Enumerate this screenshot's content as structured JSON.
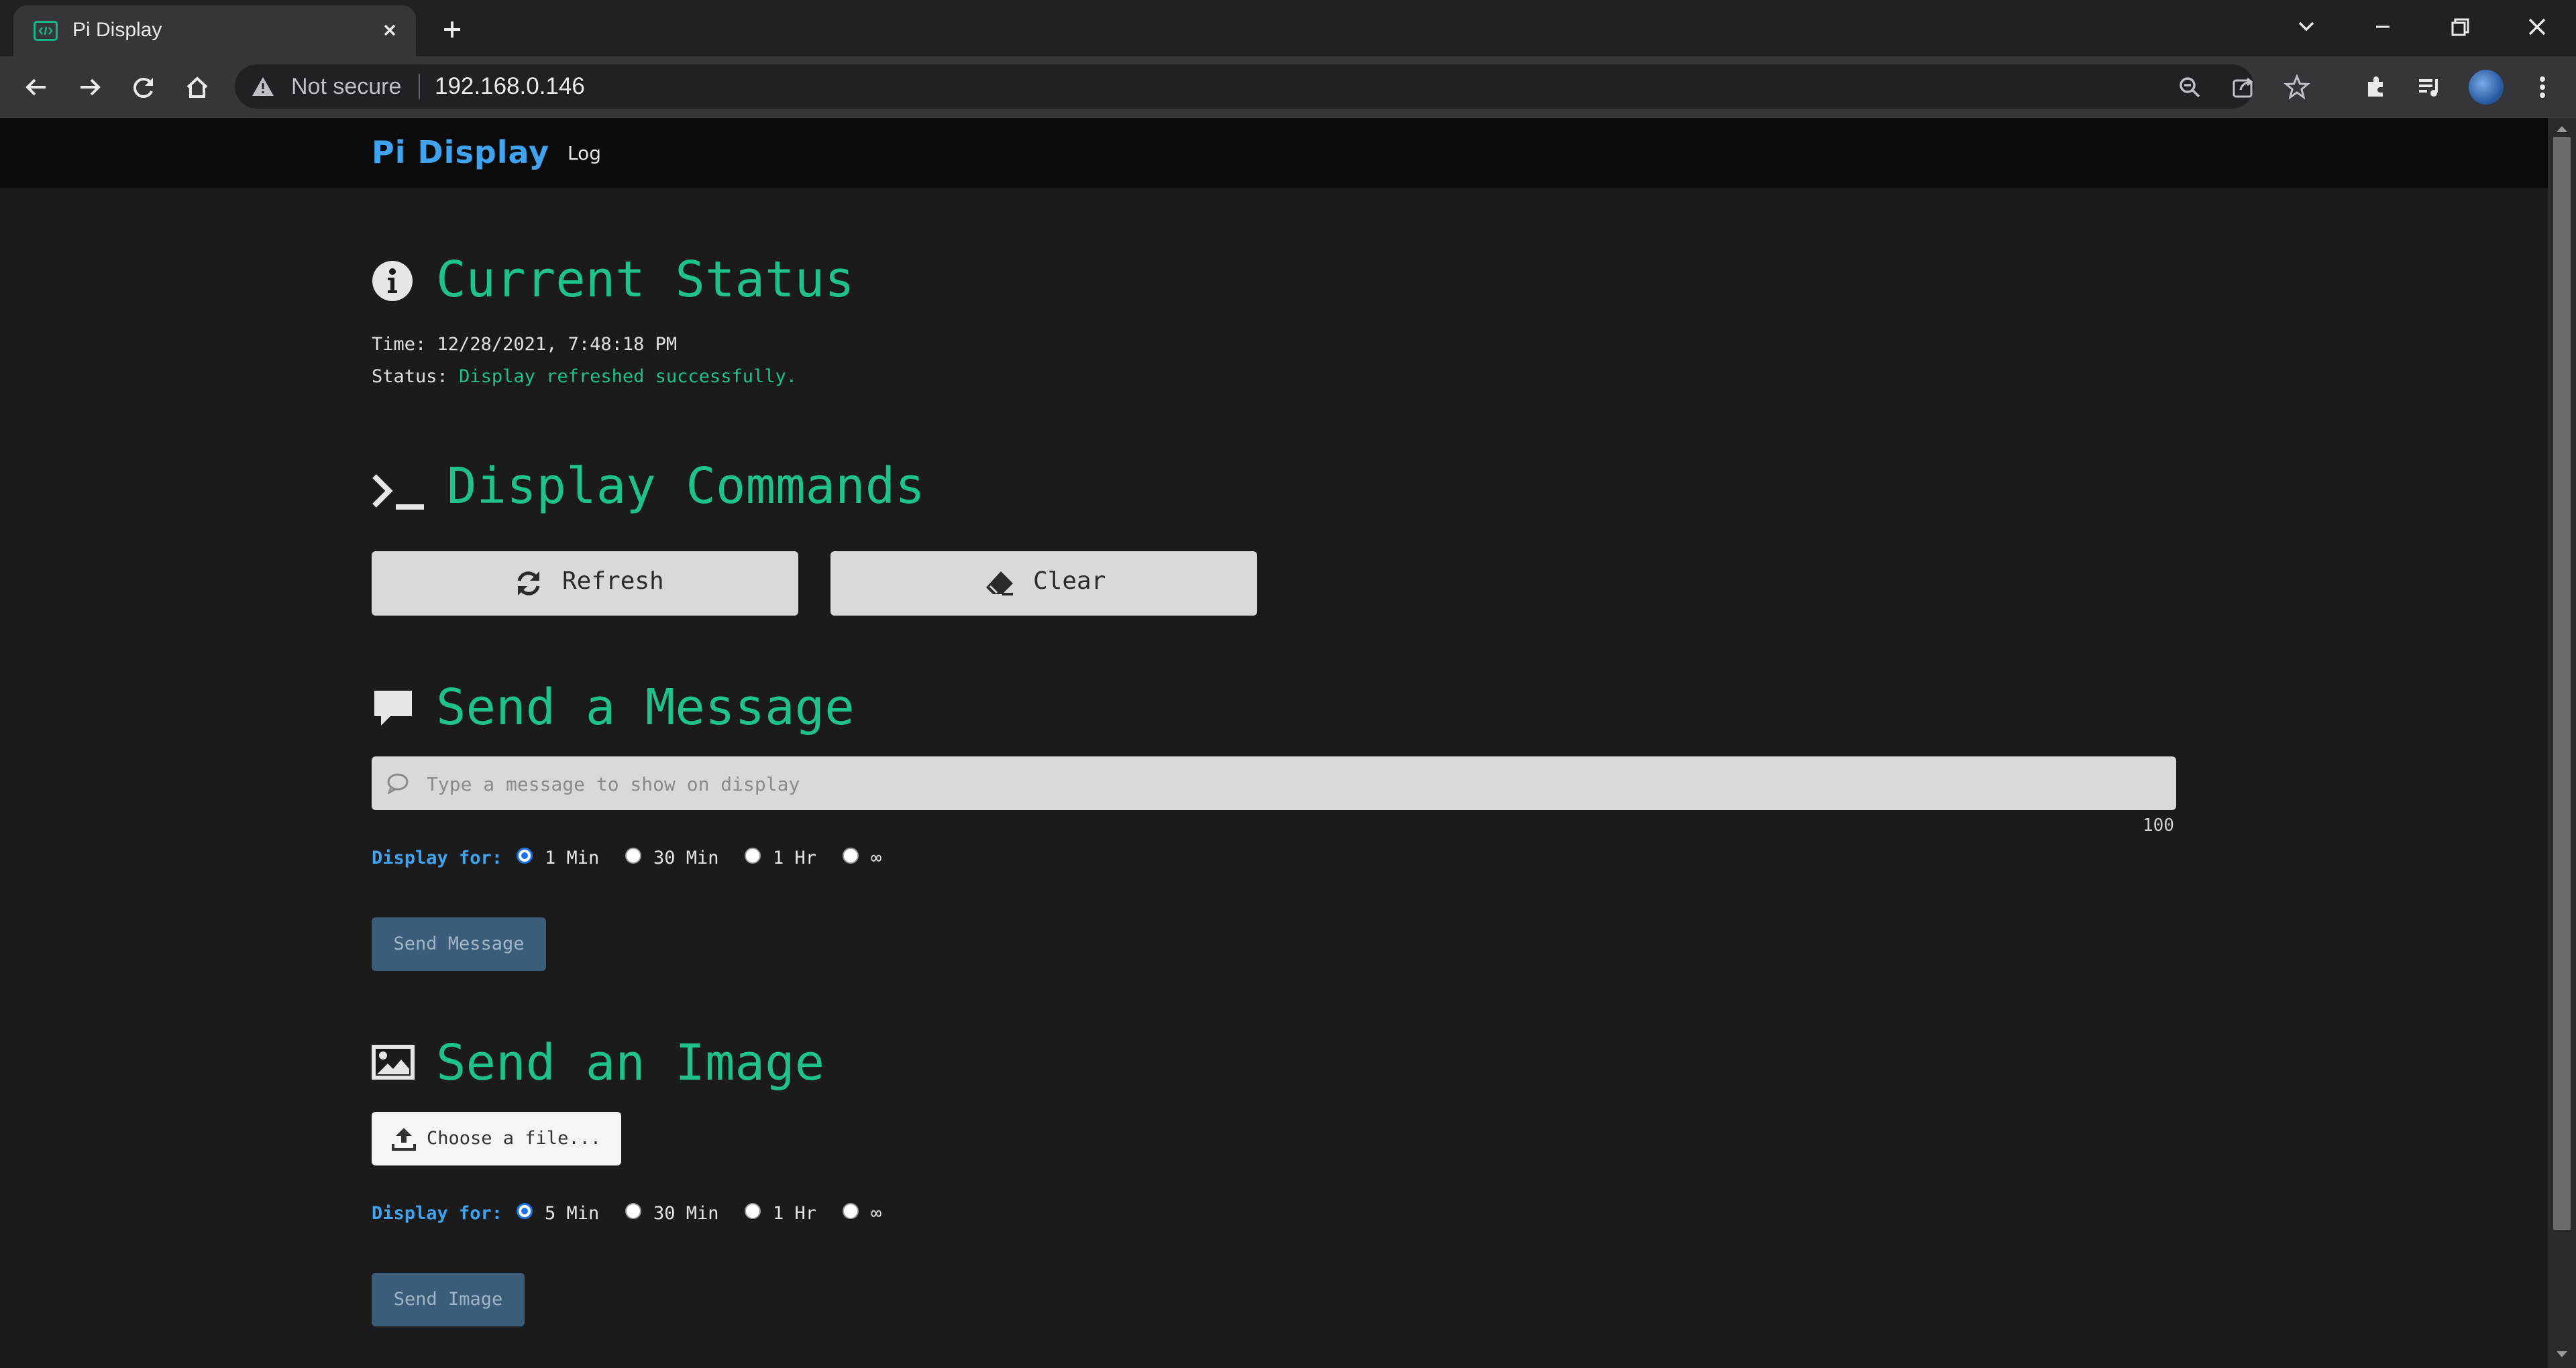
{
  "browser": {
    "tab_title": "Pi Display",
    "omnibox": {
      "security_label": "Not secure",
      "url": "192.168.0.146"
    }
  },
  "nav": {
    "brand": "Pi Display",
    "log_link": "Log"
  },
  "status": {
    "title": "Current Status",
    "time_label": "Time:",
    "time_value": "12/28/2021, 7:48:18 PM",
    "status_label": "Status:",
    "status_value": "Display refreshed successfully."
  },
  "commands": {
    "title": "Display Commands",
    "refresh_label": "Refresh",
    "clear_label": "Clear"
  },
  "message": {
    "title": "Send a Message",
    "placeholder": "Type a message to show on display",
    "value": "",
    "char_count": "100",
    "display_for_label": "Display for:",
    "options": [
      "1 Min",
      "30 Min",
      "1 Hr",
      "∞"
    ],
    "selected": "1 Min",
    "send_label": "Send Message"
  },
  "image": {
    "title": "Send an Image",
    "choose_label": "Choose a file...",
    "display_for_label": "Display for:",
    "options": [
      "5 Min",
      "30 Min",
      "1 Hr",
      "∞"
    ],
    "selected": "5 Min",
    "send_label": "Send Image"
  },
  "colors": {
    "accent_green": "#1ec28a",
    "accent_blue": "#3fa3f0",
    "background": "#1b1b1b",
    "navbar": "#0b0b0b",
    "send_button": "#3b5d7a"
  }
}
